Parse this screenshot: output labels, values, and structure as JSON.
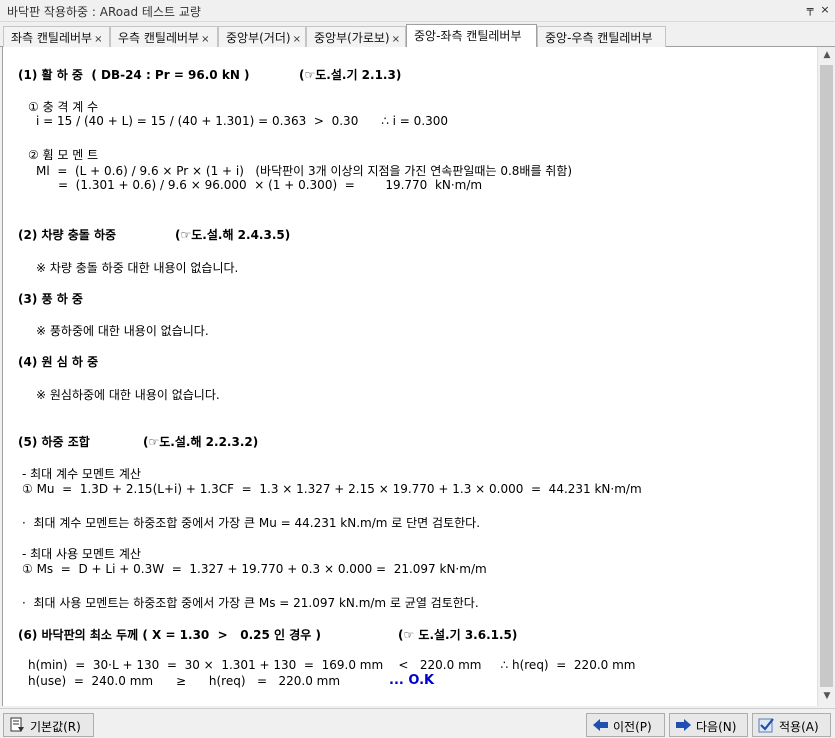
{
  "window": {
    "title": "바닥판 작용하중 : ARoad 테스트 교량",
    "pin_glyph": "╤",
    "close_glyph": "×"
  },
  "tabs": [
    {
      "label": "좌측 캔틸레버부",
      "close": "×",
      "active": false
    },
    {
      "label": "우측 캔틸레버부",
      "close": "×",
      "active": false
    },
    {
      "label": "중앙부(거더)",
      "close": "×",
      "active": false
    },
    {
      "label": "중앙부(가로보)",
      "close": "×",
      "active": false
    },
    {
      "label": "중앙-좌측 캔틸레버부",
      "close": "",
      "active": true
    },
    {
      "label": "중앙-우측 캔틸레버부",
      "close": "",
      "active": false
    }
  ],
  "report": {
    "s1_title": "(1) 활 하 중  ( DB-24 : Pr = 96.0 kN )",
    "s1_ref": "(☞도.설.기 2.1.3)",
    "s1_a_title": "① 충 격 계 수",
    "s1_a_eq": "i = 15 / (40 + L) = 15 / (40 + 1.301) = 0.363  >  0.30      ∴ i = 0.300",
    "s1_b_title": "② 휨 모 멘 트",
    "s1_b_eq1": "Ml  =  (L + 0.6) / 9.6 × Pr × (1 + i)   (바닥판이 3개 이상의 지점을 가진 연속판일때는 0.8배를 취함)",
    "s1_b_eq2": "=  (1.301 + 0.6) / 9.6 × 96.000  × (1 + 0.300)  =        19.770  kN·m/m",
    "s2_title": "(2) 차량 충돌 하중",
    "s2_ref": "(☞도.설.해 2.4.3.5)",
    "s2_note": "※ 차량 충돌 하중 대한 내용이 없습니다.",
    "s3_title": "(3) 풍 하 중",
    "s3_note": "※ 풍하중에 대한 내용이 없습니다.",
    "s4_title": "(4) 원 심 하 중",
    "s4_note": "※ 원심하중에 대한 내용이 없습니다.",
    "s5_title": "(5) 하중 조합",
    "s5_ref": "(☞도.설.해 2.2.3.2)",
    "s5_a_title": "- 최대 계수 모멘트 계산",
    "s5_a_eq": "① Mu  =  1.3D + 2.15(L+i) + 1.3CF  =  1.3 × 1.327 + 2.15 × 19.770 + 1.3 × 0.000  =  44.231 kN·m/m",
    "s5_a_note": "·  최대 계수 모멘트는 하중조합 중에서 가장 큰 Mu = 44.231 kN.m/m 로 단면 검토한다.",
    "s5_b_title": "- 최대 사용 모멘트 계산",
    "s5_b_eq": "① Ms  =  D + Li + 0.3W  =  1.327 + 19.770 + 0.3 × 0.000 =  21.097 kN·m/m",
    "s5_b_note": "·  최대 사용 모멘트는 하중조합 중에서 가장 큰 Ms = 21.097 kN.m/m 로 균열 검토한다.",
    "s6_title": "(6) 바닥판의 최소 두께 ( X = 1.30  >   0.25 인 경우 )",
    "s6_ref": "(☞ 도.설.기 3.6.1.5)",
    "s6_eq1": "h(min)  =  30·L + 130  =  30 ×  1.301 + 130  =  169.0 mm    <   220.0 mm     ∴ h(req)  =  220.0 mm",
    "s6_eq2": "h(use)  =  240.0 mm      ≥      h(req)   =   220.0 mm",
    "s6_ok": "... O.K"
  },
  "buttons": {
    "default": "기본값(R)",
    "prev": "이전(P)",
    "next": "다음(N)",
    "apply": "적용(A)"
  },
  "colors": {
    "ok_text": "#0000cc",
    "arrow_blue": "#1f4fb0"
  }
}
